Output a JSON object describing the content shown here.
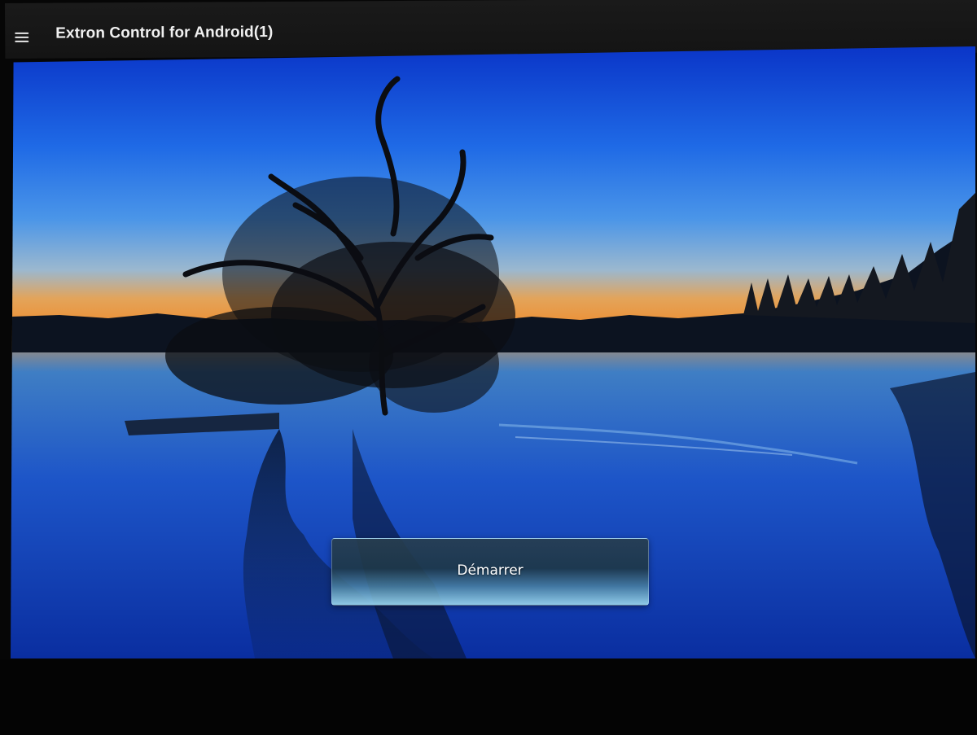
{
  "app_bar": {
    "title": "Extron Control for Android(1)",
    "menu_icon": "hamburger-menu-icon"
  },
  "main": {
    "start_button_label": "Démarrer"
  }
}
